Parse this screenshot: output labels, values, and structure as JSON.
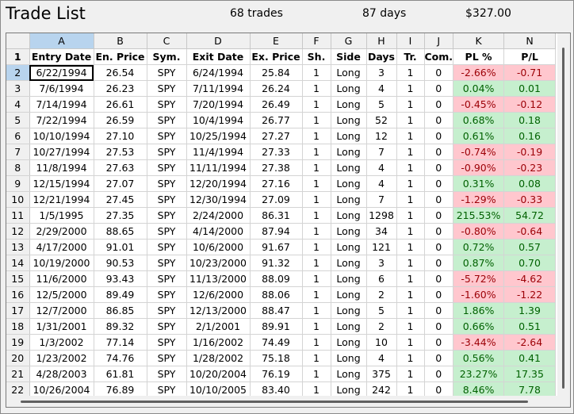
{
  "window": {
    "title": "Trade List",
    "trades_label": "68 trades",
    "days_label": "87 days",
    "profit_label": "$327.00"
  },
  "grid": {
    "column_letters": [
      "A",
      "B",
      "C",
      "D",
      "E",
      "F",
      "G",
      "H",
      "I",
      "J",
      "K",
      "N"
    ],
    "field_headers": [
      "Entry Date",
      "En. Price",
      "Sym.",
      "Exit Date",
      "Ex. Price",
      "Sh.",
      "Side",
      "Days",
      "Tr.",
      "Com.",
      "PL %",
      "P/L"
    ],
    "header_row_number": "1",
    "selected_column": "A",
    "active_cell": {
      "row": "2",
      "column": "A"
    },
    "rows": [
      {
        "n": "2",
        "cells": [
          "6/22/1994",
          "26.54",
          "SPY",
          "6/24/1994",
          "25.84",
          "1",
          "Long",
          "3",
          "1",
          "0",
          "-2.66%",
          "-0.71"
        ],
        "status": "loss"
      },
      {
        "n": "3",
        "cells": [
          "7/6/1994",
          "26.23",
          "SPY",
          "7/11/1994",
          "26.24",
          "1",
          "Long",
          "4",
          "1",
          "0",
          "0.04%",
          "0.01"
        ],
        "status": "gain"
      },
      {
        "n": "4",
        "cells": [
          "7/14/1994",
          "26.61",
          "SPY",
          "7/20/1994",
          "26.49",
          "1",
          "Long",
          "5",
          "1",
          "0",
          "-0.45%",
          "-0.12"
        ],
        "status": "loss"
      },
      {
        "n": "5",
        "cells": [
          "7/22/1994",
          "26.59",
          "SPY",
          "10/4/1994",
          "26.77",
          "1",
          "Long",
          "52",
          "1",
          "0",
          "0.68%",
          "0.18"
        ],
        "status": "gain"
      },
      {
        "n": "6",
        "cells": [
          "10/10/1994",
          "27.10",
          "SPY",
          "10/25/1994",
          "27.27",
          "1",
          "Long",
          "12",
          "1",
          "0",
          "0.61%",
          "0.16"
        ],
        "status": "gain"
      },
      {
        "n": "7",
        "cells": [
          "10/27/1994",
          "27.53",
          "SPY",
          "11/4/1994",
          "27.33",
          "1",
          "Long",
          "7",
          "1",
          "0",
          "-0.74%",
          "-0.19"
        ],
        "status": "loss"
      },
      {
        "n": "8",
        "cells": [
          "11/8/1994",
          "27.63",
          "SPY",
          "11/11/1994",
          "27.38",
          "1",
          "Long",
          "4",
          "1",
          "0",
          "-0.90%",
          "-0.23"
        ],
        "status": "loss"
      },
      {
        "n": "9",
        "cells": [
          "12/15/1994",
          "27.07",
          "SPY",
          "12/20/1994",
          "27.16",
          "1",
          "Long",
          "4",
          "1",
          "0",
          "0.31%",
          "0.08"
        ],
        "status": "gain"
      },
      {
        "n": "10",
        "cells": [
          "12/21/1994",
          "27.45",
          "SPY",
          "12/30/1994",
          "27.09",
          "1",
          "Long",
          "7",
          "1",
          "0",
          "-1.29%",
          "-0.33"
        ],
        "status": "loss"
      },
      {
        "n": "11",
        "cells": [
          "1/5/1995",
          "27.35",
          "SPY",
          "2/24/2000",
          "86.31",
          "1",
          "Long",
          "1298",
          "1",
          "0",
          "215.53%",
          "54.72"
        ],
        "status": "gain"
      },
      {
        "n": "12",
        "cells": [
          "2/29/2000",
          "88.65",
          "SPY",
          "4/14/2000",
          "87.94",
          "1",
          "Long",
          "34",
          "1",
          "0",
          "-0.80%",
          "-0.64"
        ],
        "status": "loss"
      },
      {
        "n": "13",
        "cells": [
          "4/17/2000",
          "91.01",
          "SPY",
          "10/6/2000",
          "91.67",
          "1",
          "Long",
          "121",
          "1",
          "0",
          "0.72%",
          "0.57"
        ],
        "status": "gain"
      },
      {
        "n": "14",
        "cells": [
          "10/19/2000",
          "90.53",
          "SPY",
          "10/23/2000",
          "91.32",
          "1",
          "Long",
          "3",
          "1",
          "0",
          "0.87%",
          "0.70"
        ],
        "status": "gain"
      },
      {
        "n": "15",
        "cells": [
          "11/6/2000",
          "93.43",
          "SPY",
          "11/13/2000",
          "88.09",
          "1",
          "Long",
          "6",
          "1",
          "0",
          "-5.72%",
          "-4.62"
        ],
        "status": "loss"
      },
      {
        "n": "16",
        "cells": [
          "12/5/2000",
          "89.49",
          "SPY",
          "12/6/2000",
          "88.06",
          "1",
          "Long",
          "2",
          "1",
          "0",
          "-1.60%",
          "-1.22"
        ],
        "status": "loss"
      },
      {
        "n": "17",
        "cells": [
          "12/7/2000",
          "86.85",
          "SPY",
          "12/13/2000",
          "88.47",
          "1",
          "Long",
          "5",
          "1",
          "0",
          "1.86%",
          "1.39"
        ],
        "status": "gain"
      },
      {
        "n": "18",
        "cells": [
          "1/31/2001",
          "89.32",
          "SPY",
          "2/1/2001",
          "89.91",
          "1",
          "Long",
          "2",
          "1",
          "0",
          "0.66%",
          "0.51"
        ],
        "status": "gain"
      },
      {
        "n": "19",
        "cells": [
          "1/3/2002",
          "77.14",
          "SPY",
          "1/16/2002",
          "74.49",
          "1",
          "Long",
          "10",
          "1",
          "0",
          "-3.44%",
          "-2.64"
        ],
        "status": "loss"
      },
      {
        "n": "20",
        "cells": [
          "1/23/2002",
          "74.76",
          "SPY",
          "1/28/2002",
          "75.18",
          "1",
          "Long",
          "4",
          "1",
          "0",
          "0.56%",
          "0.41"
        ],
        "status": "gain"
      },
      {
        "n": "21",
        "cells": [
          "4/28/2003",
          "61.81",
          "SPY",
          "10/20/2004",
          "76.19",
          "1",
          "Long",
          "375",
          "1",
          "0",
          "23.27%",
          "17.35"
        ],
        "status": "gain"
      },
      {
        "n": "22",
        "cells": [
          "10/26/2004",
          "76.89",
          "SPY",
          "10/10/2005",
          "83.40",
          "1",
          "Long",
          "242",
          "1",
          "0",
          "8.46%",
          "7.78"
        ],
        "status": "gain"
      }
    ]
  },
  "colors": {
    "loss_fill": "#ffc7ce",
    "loss_text": "#9c0006",
    "gain_fill": "#c6efce",
    "gain_text": "#006100",
    "selection": "#b8d4ee"
  }
}
